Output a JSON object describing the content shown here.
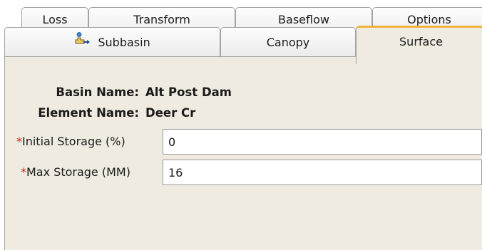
{
  "tabs_row1": [
    {
      "label": "Loss"
    },
    {
      "label": "Transform"
    },
    {
      "label": "Baseflow"
    },
    {
      "label": "Options"
    }
  ],
  "tabs_row2": [
    {
      "label": "Subbasin",
      "icon": "subbasin-icon"
    },
    {
      "label": "Canopy"
    },
    {
      "label": "Surface",
      "selected": true
    }
  ],
  "info": {
    "basin_label": "Basin Name:",
    "basin_value": "Alt Post Dam",
    "element_label": "Element Name:",
    "element_value": "Deer Cr"
  },
  "fields": {
    "required_marker": "*",
    "initial_storage_label": "Initial Storage (%)",
    "initial_storage_value": "0",
    "max_storage_label": "Max Storage (MM)",
    "max_storage_value": "16"
  },
  "colors": {
    "active_tab_accent": "#f2b33a",
    "panel_bg": "#f0ebe0",
    "required_marker": "#d62020"
  }
}
